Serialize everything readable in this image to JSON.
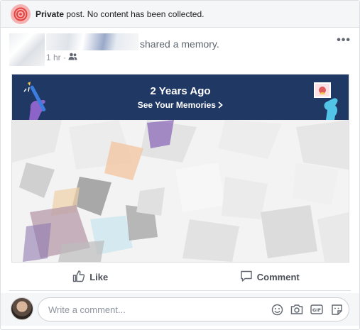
{
  "notice": {
    "bold": "Private",
    "text": " post. No content has been collected."
  },
  "post": {
    "action": "shared a memory.",
    "time": "1 hr ·",
    "more": "•••"
  },
  "memory": {
    "title": "2 Years Ago",
    "link": "See Your Memories"
  },
  "actions": {
    "like": "Like",
    "comment": "Comment"
  },
  "comment_box": {
    "placeholder": "Write a comment..."
  },
  "icons": {
    "privacy": "private-post-icon",
    "audience": "friends-icon",
    "more": "more-options-icon",
    "like": "thumbs-up-icon",
    "comment": "speech-bubble-icon",
    "emoji": "emoji-icon",
    "camera": "camera-icon",
    "gif": "gif-icon",
    "sticker": "sticker-icon"
  },
  "colors": {
    "banner": "#203864",
    "notice_icon": "#e4423f"
  }
}
